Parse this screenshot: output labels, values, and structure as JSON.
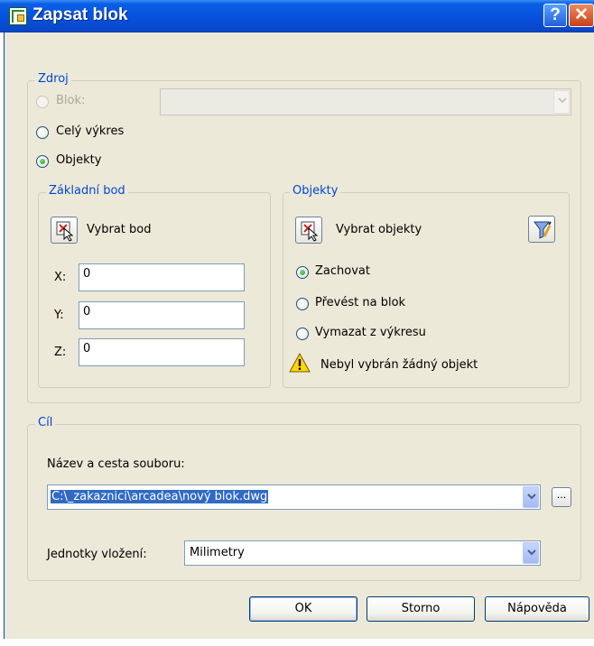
{
  "window": {
    "title": "Zapsat blok",
    "help_glyph": "?",
    "close_glyph": "✕"
  },
  "source": {
    "group_title": "Zdroj",
    "block_label": "Blok:",
    "block_value": "",
    "whole_drawing_label": "Celý výkres",
    "objects_label": "Objekty",
    "selected_option": "Objekty"
  },
  "base_point": {
    "group_title": "Základní bod",
    "pick_label": "Vybrat bod",
    "x_label": "X:",
    "x_value": "0",
    "y_label": "Y:",
    "y_value": "0",
    "z_label": "Z:",
    "z_value": "0"
  },
  "objects": {
    "group_title": "Objekty",
    "select_label": "Vybrat objekty",
    "retain_label": "Zachovat",
    "convert_label": "Převést na blok",
    "delete_label": "Vymazat z výkresu",
    "selected_option": "Zachovat",
    "warning": "Nebyl vybrán žádný objekt"
  },
  "destination": {
    "group_title": "Cíl",
    "path_label": "Název a cesta souboru:",
    "path_value": "C:\\_zakaznici\\arcadea\\nový blok.dwg",
    "browse_label": "...",
    "units_label": "Jednotky vložení:",
    "units_value": "Milimetry"
  },
  "buttons": {
    "ok": "OK",
    "cancel": "Storno",
    "help": "Nápověda"
  },
  "colors": {
    "title_bar": "#0551de",
    "group_title": "#0046d5",
    "dialog_bg": "#ece9d8",
    "selection": "#316ac5"
  }
}
